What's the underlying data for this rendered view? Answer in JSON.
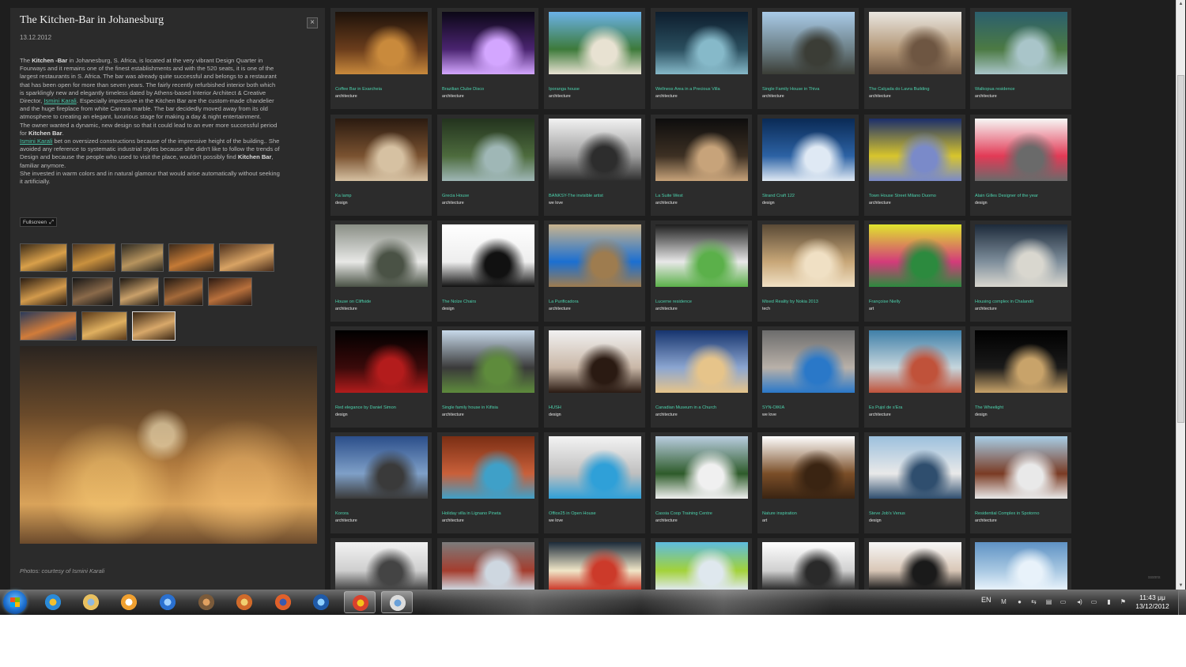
{
  "article": {
    "title": "The Kitchen-Bar in Johanesburg",
    "date": "13.12.2012",
    "close_label": "×",
    "p1": [
      {
        "t": "The "
      },
      {
        "t": "Kitchen -Bar",
        "b": true
      },
      {
        "t": " in Johanesburg, S. Africa, is located at the very vibrant Design Quarter in Fourways and it remains one of the finest establishments and with the 520 seats, it is one of the largest restaurants in S. Africa. The bar was already quite successful and belongs to a restaurant that has been open for more than seven years. The fairly recently refurbished interior both which is sparklingly new and elegantly timeless dated by Athens-based Interior Architect & Creative Director, "
      },
      {
        "t": "Ismini Karali",
        "a": true
      },
      {
        "t": ". Especially impressive in the Kitchen Bar are the custom-made chandelier and the huge fireplace from white Carrara marble. The bar decidedly moved away from its old atmosphere to creating an elegant, luxurious stage for making a day & night entertainment."
      }
    ],
    "p2": [
      {
        "t": "The owner wanted a dynamic, new design so that it could lead to an ever more successful period for "
      },
      {
        "t": "Kitchen Bar",
        "b": true
      },
      {
        "t": "."
      }
    ],
    "p3": [
      {
        "t": "Ismini Karali",
        "a": true
      },
      {
        "t": " bet on oversized constructions because of the impressive height of the building.. She avoided any reference to systematic industrial styles because she didn't like to follow the trends of Design and because the people who used to visit the place, wouldn't possibly find "
      },
      {
        "t": "Kitchen Bar",
        "b": true
      },
      {
        "t": ", familiar anymore."
      }
    ],
    "p4": [
      {
        "t": "She invested in warm colors and in natural glamour that would arise automatically without seeking it artificially."
      }
    ],
    "fullscreen_label": "Fullscreen",
    "credit": "Photos: courtesy of Ismini Karali"
  },
  "grid": [
    {
      "title": "Coffee Bar in Exarcheia",
      "cat": "architecture",
      "c": [
        "#1d120a",
        "#6b3d1c",
        "#c98a3c"
      ]
    },
    {
      "title": "Brazilian Clube Disco",
      "cat": "architecture",
      "c": [
        "#0b0716",
        "#4a2470",
        "#d3a6ff"
      ]
    },
    {
      "title": "Iporanga house",
      "cat": "architecture",
      "c": [
        "#6bb2e8",
        "#3d7a3a",
        "#e8e2d2"
      ]
    },
    {
      "title": "Wellness Area in a Precious Villa",
      "cat": "architecture",
      "c": [
        "#0d1d2d",
        "#2a4e5e",
        "#86b9c9"
      ]
    },
    {
      "title": "Single Family House in Thiva",
      "cat": "architecture",
      "c": [
        "#a9cbe8",
        "#6c7f86",
        "#3b3d36"
      ]
    },
    {
      "title": "The Calçada do Lavra Building",
      "cat": "architecture",
      "c": [
        "#e9e6e0",
        "#b39777",
        "#6e5642"
      ]
    },
    {
      "title": "Walkopua residence",
      "cat": "architecture",
      "c": [
        "#2b5f6e",
        "#4c7a43",
        "#a9c5c9"
      ]
    },
    {
      "title": "Ka lamp",
      "cat": "design",
      "c": [
        "#2a1a10",
        "#7a5230",
        "#d6c1a2"
      ]
    },
    {
      "title": "Grecia House",
      "cat": "architecture",
      "c": [
        "#23331e",
        "#4d6b3d",
        "#9fb7b6"
      ]
    },
    {
      "title": "BANKSY-The invisible artist",
      "cat": "we love",
      "c": [
        "#f2f2f2",
        "#9e9e9e",
        "#2d2d2d"
      ]
    },
    {
      "title": "La Suite West",
      "cat": "architecture",
      "c": [
        "#0d0d0d",
        "#3d3023",
        "#c7a37a"
      ]
    },
    {
      "title": "Strand Craft 122",
      "cat": "design",
      "c": [
        "#0a2a55",
        "#2c62a4",
        "#dfe9f4"
      ]
    },
    {
      "title": "Town House Street Milano Duomo",
      "cat": "architecture",
      "c": [
        "#1b2e6b",
        "#d8c52c",
        "#7a8ac9"
      ]
    },
    {
      "title": "Alain Gilles Designer of the year",
      "cat": "design",
      "c": [
        "#f7f7f5",
        "#e23a56",
        "#6a6a6a"
      ]
    },
    {
      "title": "House on Cliffside",
      "cat": "architecture",
      "c": [
        "#8a8f86",
        "#e8e8e6",
        "#4a5245"
      ]
    },
    {
      "title": "The Nolze Chairs",
      "cat": "design",
      "c": [
        "#ffffff",
        "#eeeeee",
        "#111111"
      ]
    },
    {
      "title": "La Purificadora",
      "cat": "architecture",
      "c": [
        "#c9b48e",
        "#1b6fd1",
        "#9e7c4f"
      ]
    },
    {
      "title": "Lucerne residence",
      "cat": "architecture",
      "c": [
        "#1e1e1e",
        "#e8e8e8",
        "#5bb04a"
      ]
    },
    {
      "title": "Mixed Reality by Nokia 2013",
      "cat": "tech",
      "c": [
        "#5a4a36",
        "#c8a778",
        "#f0e0c4"
      ]
    },
    {
      "title": "Françoise Nielly",
      "cat": "art",
      "c": [
        "#e0e52e",
        "#d33b7a",
        "#2c8a3e"
      ]
    },
    {
      "title": "Housing complex in Chalandri",
      "cat": "architecture",
      "c": [
        "#1d2a3a",
        "#7f8f9c",
        "#d9d7cf"
      ]
    },
    {
      "title": "Red elegance by Daniel Simon",
      "cat": "design",
      "c": [
        "#000000",
        "#3a0a0a",
        "#b31c1c"
      ]
    },
    {
      "title": "Single family house in Kifisia",
      "cat": "architecture",
      "c": [
        "#c7d9ea",
        "#3a3a3a",
        "#5e8b3c"
      ]
    },
    {
      "title": "HUSH",
      "cat": "design",
      "c": [
        "#f1f1f1",
        "#c9b7a7",
        "#2a1a12"
      ]
    },
    {
      "title": "Canadian Museum in a Church",
      "cat": "architecture",
      "c": [
        "#16346e",
        "#8ca6d1",
        "#e6c48a"
      ]
    },
    {
      "title": "SYN-OIKIA",
      "cat": "we love",
      "c": [
        "#6c6c6c",
        "#b9b1a9",
        "#2a78c8"
      ]
    },
    {
      "title": "Es Pujol de s'Era",
      "cat": "architecture",
      "c": [
        "#3f7fa8",
        "#c6d6dd",
        "#c0523a"
      ]
    },
    {
      "title": "The Wheelight",
      "cat": "design",
      "c": [
        "#000000",
        "#1a1a1a",
        "#c8a36a"
      ]
    },
    {
      "title": "Korora",
      "cat": "architecture",
      "c": [
        "#2b4e8a",
        "#7fa0c8",
        "#3a3a3a"
      ]
    },
    {
      "title": "Holiday villa in Lignano Pineta",
      "cat": "architecture",
      "c": [
        "#7a2e14",
        "#c9603a",
        "#3fa0c8"
      ]
    },
    {
      "title": "Office25 in Open House",
      "cat": "we love",
      "c": [
        "#f3f3f3",
        "#bfbfbf",
        "#2fa0d8"
      ]
    },
    {
      "title": "Cassia Coop Training Centre",
      "cat": "architecture",
      "c": [
        "#b9cde0",
        "#2e5b2a",
        "#f0f0f0"
      ]
    },
    {
      "title": "Nature inspiration",
      "cat": "art",
      "c": [
        "#ffffff",
        "#7a4e28",
        "#3a2412"
      ]
    },
    {
      "title": "Steve Job's Venus",
      "cat": "design",
      "c": [
        "#9cc0dd",
        "#e9e9e9",
        "#2f4e6e"
      ]
    },
    {
      "title": "Residential Complex in Spotorno",
      "cat": "architecture",
      "c": [
        "#a7cde6",
        "#7a3b24",
        "#e9e9e9"
      ]
    },
    {
      "title": "",
      "cat": "",
      "c": [
        "#f2f2f2",
        "#cfcfcf",
        "#444444"
      ]
    },
    {
      "title": "",
      "cat": "",
      "c": [
        "#7c7c7c",
        "#a43d2e",
        "#ced7e0"
      ]
    },
    {
      "title": "",
      "cat": "",
      "c": [
        "#1c2b3a",
        "#f0e6c8",
        "#cc3a2a"
      ]
    },
    {
      "title": "",
      "cat": "",
      "c": [
        "#5dbbe0",
        "#a3d23a",
        "#dfe8ee"
      ]
    },
    {
      "title": "",
      "cat": "",
      "c": [
        "#ffffff",
        "#d0d0d0",
        "#2a2a2a"
      ]
    },
    {
      "title": "",
      "cat": "",
      "c": [
        "#f7f7f7",
        "#d9c7b7",
        "#1a1a1a"
      ]
    },
    {
      "title": "",
      "cat": "",
      "c": [
        "#5f92c4",
        "#a8c8e2",
        "#e8f2fa"
      ]
    }
  ],
  "panel_thumbs": [
    {
      "c": [
        "#3a2a18",
        "#d9a04a"
      ]
    },
    {
      "c": [
        "#4a3420",
        "#c9913e"
      ]
    },
    {
      "c": [
        "#2e2a22",
        "#b7945e"
      ]
    },
    {
      "c": [
        "#3c2a1a",
        "#c47a36"
      ]
    },
    {
      "c": [
        "#4a2e1c",
        "#d8a364"
      ]
    },
    {
      "c": [
        "#2a1c12",
        "#d29a4c"
      ]
    },
    {
      "c": [
        "#161616",
        "#8a6a4a"
      ]
    },
    {
      "c": [
        "#1c1712",
        "#c9a06a"
      ]
    },
    {
      "c": [
        "#201812",
        "#a46a3a"
      ]
    },
    {
      "c": [
        "#2c1a12",
        "#b8703c"
      ]
    },
    {
      "c": [
        "#2a3a5a",
        "#d17c3a"
      ]
    },
    {
      "c": [
        "#5a3a1a",
        "#e0b060"
      ]
    },
    {
      "c": [
        "#3a2614",
        "#d8a86a"
      ]
    }
  ],
  "taskbar": {
    "apps": [
      {
        "name": "ie-icon",
        "c": [
          "#2a8ad8",
          "#f0c030"
        ]
      },
      {
        "name": "file-explorer-icon",
        "c": [
          "#e8c060",
          "#8fb8e0"
        ]
      },
      {
        "name": "media-player-icon",
        "c": [
          "#f0a030",
          "#ffffff"
        ]
      },
      {
        "name": "sync-icon",
        "c": [
          "#2a70d0",
          "#9fd0ff"
        ]
      },
      {
        "name": "paint-icon",
        "c": [
          "#7a5a3a",
          "#e0a060"
        ]
      },
      {
        "name": "office-icon",
        "c": [
          "#d06a2a",
          "#f0d070"
        ]
      },
      {
        "name": "firefox-icon",
        "c": [
          "#e0602a",
          "#3a5ab0"
        ]
      },
      {
        "name": "photoshop-icon",
        "c": [
          "#1f5aa8",
          "#8fd0ff"
        ]
      },
      {
        "name": "chrome-icon",
        "c": [
          "#d9412d",
          "#f5c21b"
        ]
      },
      {
        "name": "paint-palette-icon",
        "c": [
          "#dcdcdc",
          "#6aa0d8"
        ]
      }
    ],
    "active_index": 8,
    "language": "EN",
    "time": "11:43 μμ",
    "date": "13/12/2012",
    "tray_glyphs": [
      "M",
      "●",
      "⇆",
      "▤",
      "▭",
      "◂)",
      "▭",
      "▮",
      "⚑"
    ]
  },
  "watermark": "sssnns"
}
